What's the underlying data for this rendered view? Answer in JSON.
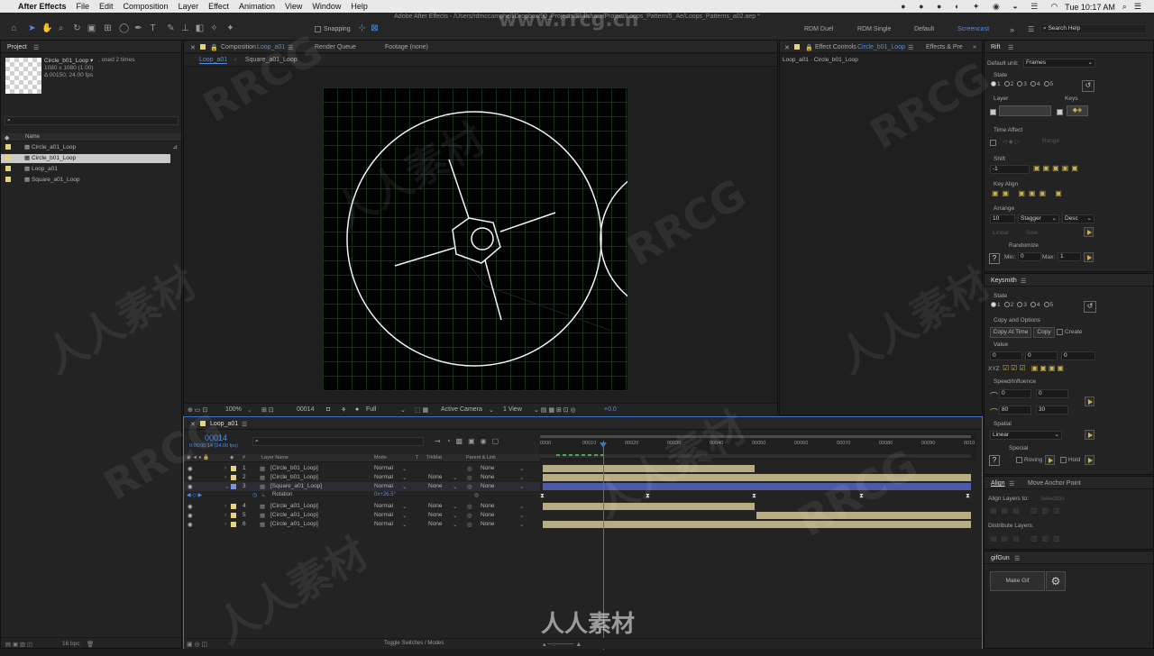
{
  "menubar": {
    "apple": "",
    "app": "After Effects",
    "items": [
      "File",
      "Edit",
      "Composition",
      "Layer",
      "Effect",
      "Animation",
      "View",
      "Window",
      "Help"
    ],
    "clock": "Tue 10:17 AM"
  },
  "title": "Adobe After Effects - /Users/rdmccamphell/Dropbox/90_Projects/Skillshare/Project/Loops_Pattern/5_Ae/Loops_Patterns_a02.aep *",
  "toolbar": {
    "snapping": "Snapping",
    "workspaces": [
      "RDM Duel",
      "RDM Single",
      "Default",
      "Screencast"
    ],
    "active_workspace": "Screencast",
    "search": "Search Help"
  },
  "project": {
    "tab": "Project",
    "item_name": "Circle_b01_Loop ▾",
    "item_used": ", used 2 times",
    "item_size": "1080 x 1080 (1.00)",
    "item_dur": "Δ 00150, 24.00 fps",
    "col_name": "Name",
    "items": [
      "Circle_a01_Loop",
      "Circle_b01_Loop",
      "Loop_a01",
      "Square_a01_Loop"
    ],
    "footer": "16 bpc"
  },
  "comp": {
    "tab_label": "Composition",
    "tab_name": "Loop_a01",
    "render_queue": "Render Queue",
    "footage": "Footage (none)",
    "sub_tabs": [
      "Loop_a01",
      "Square_a01_Loop"
    ],
    "zoom": "100%",
    "timecode": "00014",
    "resolution": "Full",
    "camera": "Active Camera",
    "view": "1 View",
    "exposure": "+0.0"
  },
  "effect_controls": {
    "tab_label": "Effect Controls",
    "tab_name": "Circle_b01_Loop",
    "effects_tab": "Effects & Pre",
    "breadcrumb": "Loop_a01 · Circle_b01_Loop"
  },
  "rift": {
    "title": "Rift",
    "default_unit_label": "Default unit:",
    "default_unit": "Frames",
    "state": "State",
    "states": [
      "1",
      "2",
      "3",
      "4",
      "5"
    ],
    "layer": "Layer",
    "keys": "Keys",
    "time_affect": "Time Affect",
    "range": "Range",
    "shift": "Shift",
    "shift_value": "-1",
    "key_align": "Key Align",
    "arrange": "Arrange",
    "arrange_value": "10",
    "stagger": "Stagger",
    "order": "Desc",
    "linear": "Linear",
    "sine": "Sine",
    "randomize": "Randomize",
    "min_label": "Min:",
    "min": "0",
    "max_label": "Max:",
    "max": "1"
  },
  "keysmith": {
    "title": "Keysmith",
    "state": "State",
    "states": [
      "1",
      "2",
      "3",
      "4",
      "5"
    ],
    "copy_options": "Copy and Options",
    "copy_at_time": "Copy At Time",
    "copy": "Copy",
    "create": "Create",
    "value": "Value",
    "values": [
      "0",
      "0",
      "0"
    ],
    "xyz": "XYZ",
    "speed": "Speed/Influence",
    "speed_vals": [
      "0",
      "0",
      "80",
      "30"
    ],
    "spatial": "Spatial",
    "spatial_value": "Linear",
    "special": "Special",
    "roving": "Roving",
    "hold": "Hold"
  },
  "align": {
    "tab": "Align",
    "move_anchor": "Move Anchor Point",
    "align_to": "Align Layers to:",
    "selection": "Selection",
    "distribute": "Distribute Layers:"
  },
  "gifgun": {
    "title": "gifGun",
    "make_gif": "Make Gif"
  },
  "timeline": {
    "tab": "Loop_a01",
    "timecode": "00014",
    "timecode_sub": "0:00:00:14 (24.00 fps)",
    "col_layer": "Layer Name",
    "col_mode": "Mode",
    "col_t": "T",
    "col_trkmat": "TrkMat",
    "col_parent": "Parent & Link",
    "ticks": [
      "0000",
      "00010",
      "00020",
      "00030",
      "00040",
      "00050",
      "00060",
      "00070",
      "00080",
      "00090",
      "0010"
    ],
    "layers": [
      {
        "num": "1",
        "name": "[Circle_b01_Loop]",
        "mode": "Normal",
        "trk": "",
        "parent": "None",
        "color": "#e6d37a"
      },
      {
        "num": "2",
        "name": "[Circle_b01_Loop]",
        "mode": "Normal",
        "trk": "None",
        "parent": "None",
        "color": "#e6d37a"
      },
      {
        "num": "3",
        "name": "[Square_a01_Loop]",
        "mode": "Normal",
        "trk": "None",
        "parent": "None",
        "color": "#7f8fd8"
      },
      {
        "num": "4",
        "name": "[Circle_a01_Loop]",
        "mode": "Normal",
        "trk": "None",
        "parent": "None",
        "color": "#e6d37a"
      },
      {
        "num": "5",
        "name": "[Circle_a01_Loop]",
        "mode": "Normal",
        "trk": "None",
        "parent": "None",
        "color": "#e6d37a"
      },
      {
        "num": "6",
        "name": "[Circle_a01_Loop]",
        "mode": "Normal",
        "trk": "None",
        "parent": "None",
        "color": "#e6d37a"
      }
    ],
    "rotation_label": "Rotation",
    "rotation_value": "0x+26.5°",
    "footer": "Toggle Switches / Modes"
  },
  "watermark": {
    "site": "www.rrcg.cn",
    "text1": "RRCG",
    "text2": "人人素材"
  }
}
